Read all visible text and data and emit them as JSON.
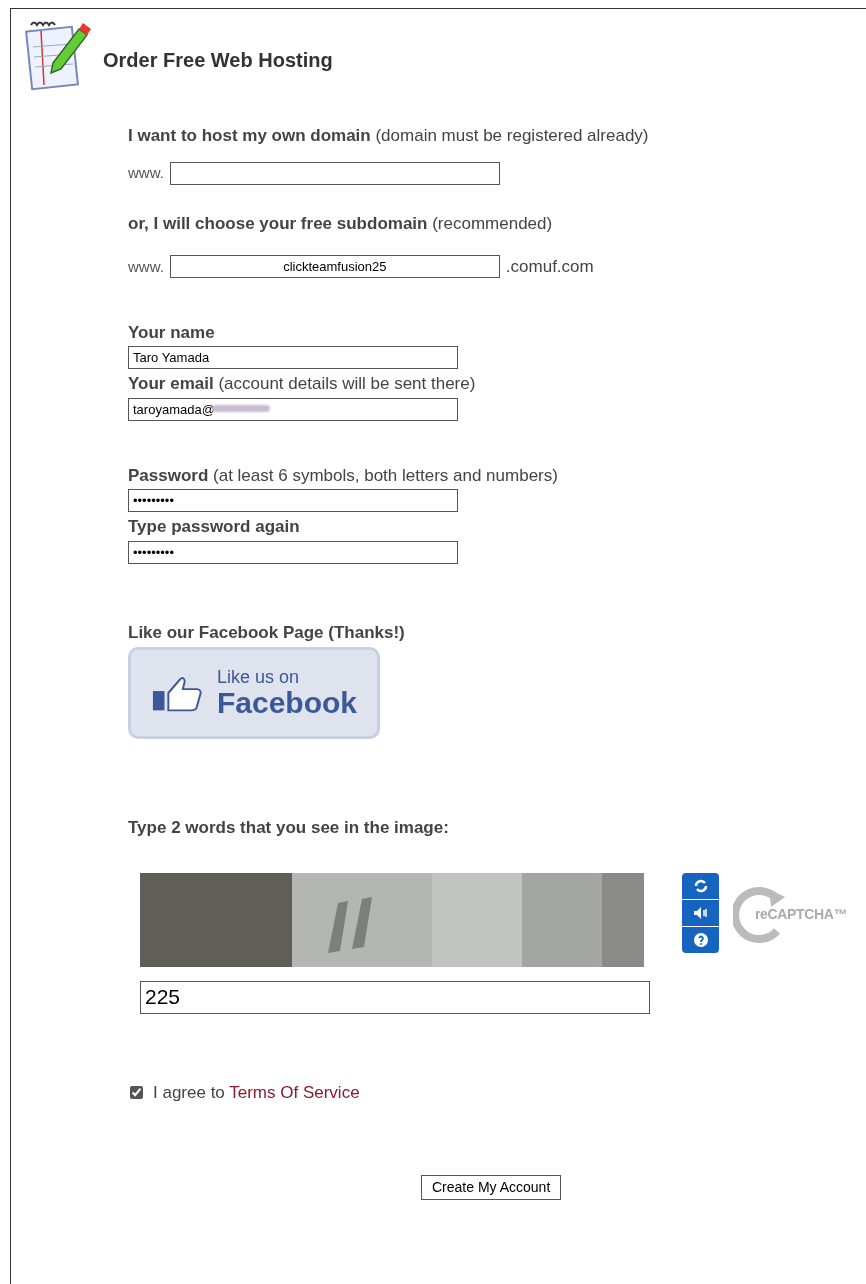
{
  "title": "Order Free Web Hosting",
  "own_domain": {
    "label": "I want to host my own domain",
    "note": "(domain must be registered already)",
    "prefix": "www."
  },
  "subdomain": {
    "label": "or, I will choose your free subdomain",
    "note": "(recommended)",
    "prefix": "www.",
    "value": "clickteamfusion25",
    "suffix": ".comuf.com"
  },
  "name": {
    "label": "Your name",
    "value": "Taro Yamada"
  },
  "email": {
    "label": "Your email",
    "note": "(account details will be sent there)",
    "value": "taroyamada@"
  },
  "password": {
    "label": "Password",
    "note": "(at least 6 symbols, both letters and numbers)",
    "value": "•••••••••"
  },
  "password_again": {
    "label": "Type password again",
    "value": "•••••••••"
  },
  "facebook": {
    "label": "Like our Facebook Page (Thanks!)",
    "button_line1": "Like us on",
    "button_line2": "Facebook"
  },
  "captcha": {
    "label": "Type 2 words that you see in the image:",
    "logo": "reCAPTCHA™",
    "value": "225"
  },
  "agree": {
    "checked": true,
    "text": "I agree to",
    "link": "Terms Of Service"
  },
  "submit": "Create My Account"
}
